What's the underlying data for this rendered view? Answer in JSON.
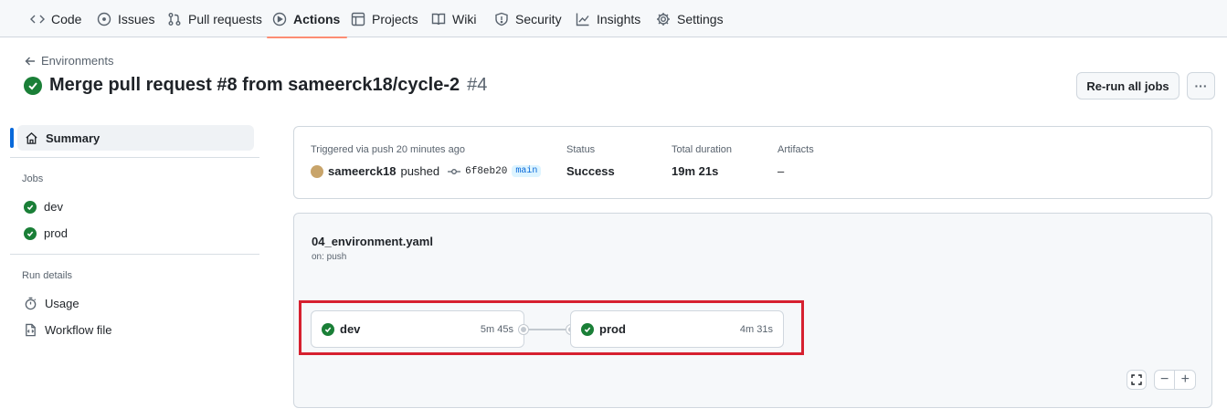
{
  "nav": {
    "tabs": [
      {
        "label": "Code",
        "icon": "code-icon"
      },
      {
        "label": "Issues",
        "icon": "issue-icon"
      },
      {
        "label": "Pull requests",
        "icon": "pull-request-icon"
      },
      {
        "label": "Actions",
        "icon": "play-icon",
        "active": true
      },
      {
        "label": "Projects",
        "icon": "table-icon"
      },
      {
        "label": "Wiki",
        "icon": "book-icon"
      },
      {
        "label": "Security",
        "icon": "shield-icon"
      },
      {
        "label": "Insights",
        "icon": "graph-icon"
      },
      {
        "label": "Settings",
        "icon": "gear-icon"
      }
    ]
  },
  "header": {
    "back_label": "Environments",
    "title": "Merge pull request #8 from sameerck18/cycle-2",
    "run_number": "#4",
    "rerun_label": "Re-run all jobs",
    "more_label": "···"
  },
  "sidebar": {
    "summary_label": "Summary",
    "jobs_heading": "Jobs",
    "jobs": [
      {
        "label": "dev",
        "status": "success"
      },
      {
        "label": "prod",
        "status": "success"
      }
    ],
    "run_details_heading": "Run details",
    "usage_label": "Usage",
    "workflow_file_label": "Workflow file"
  },
  "summary": {
    "trigger_label": "Triggered via push 20 minutes ago",
    "actor": "sameerck18",
    "action": "pushed",
    "commit": "6f8eb20",
    "branch": "main",
    "status_label": "Status",
    "status_value": "Success",
    "duration_label": "Total duration",
    "duration_value": "19m 21s",
    "artifacts_label": "Artifacts",
    "artifacts_value": "–"
  },
  "workflow": {
    "file": "04_environment.yaml",
    "trigger": "on: push",
    "jobs": [
      {
        "name": "dev",
        "duration": "5m 45s",
        "status": "success"
      },
      {
        "name": "prod",
        "duration": "4m 31s",
        "status": "success"
      }
    ],
    "zoom_out": "−",
    "zoom_in": "+"
  },
  "colors": {
    "success": "#1a7f37",
    "accent": "#fd8c73",
    "link": "#0969da",
    "highlight": "#d6202f"
  }
}
